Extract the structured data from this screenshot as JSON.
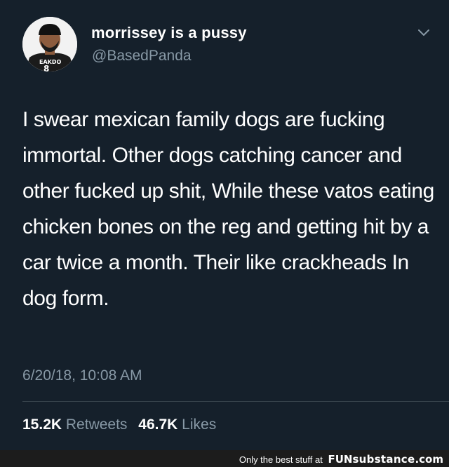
{
  "tweet": {
    "display_name": "morrissey is a pussy",
    "handle": "@BasedPanda",
    "avatar_shirt_text": "EAKDO",
    "text": "I swear mexican family dogs are fucking immortal. Other dogs catching cancer and other fucked up shit, While these vatos eating chicken bones on the reg and getting hit by a car twice a month. Their like crackheads In dog form.",
    "timestamp": "6/20/18, 10:08 AM",
    "retweets_count": "15.2K",
    "retweets_label": "Retweets",
    "likes_count": "46.7K",
    "likes_label": "Likes"
  },
  "footer": {
    "tagline": "Only the best stuff at",
    "brand_fun": "FUN",
    "brand_substance": "substance",
    "brand_domain": ".com"
  },
  "colors": {
    "background": "#15202b",
    "secondary_text": "#8899a6",
    "primary_text": "#ffffff",
    "footer_background": "#1c1c1c"
  },
  "icons": {
    "chevron": "chevron-down-icon"
  }
}
